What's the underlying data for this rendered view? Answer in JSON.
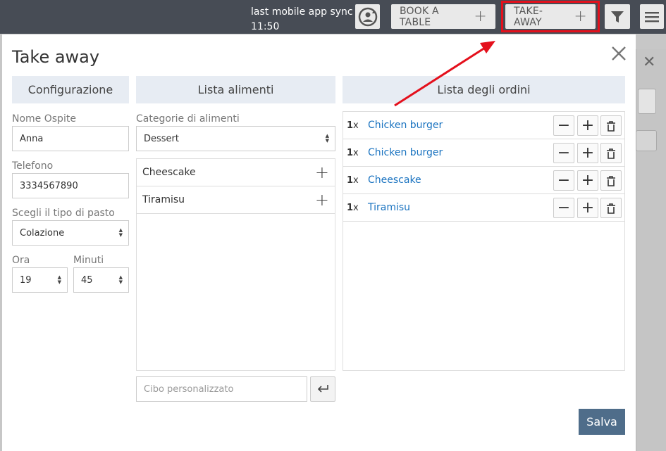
{
  "topbar": {
    "sync_label": "last mobile app sync",
    "sync_time": "11:50",
    "book_label": "BOOK A TABLE",
    "takeaway_label": "TAKE-AWAY"
  },
  "modal": {
    "title": "Take away",
    "columns": {
      "config": "Configurazione",
      "foods": "Lista alimenti",
      "orders": "Lista degli ordini"
    }
  },
  "config": {
    "guest_label": "Nome Ospite",
    "guest_value": "Anna",
    "phone_label": "Telefono",
    "phone_value": "3334567890",
    "meal_label": "Scegli il tipo di pasto",
    "meal_value": "Colazione",
    "hour_label": "Ora",
    "hour_value": "19",
    "minute_label": "Minuti",
    "minute_value": "45"
  },
  "foods": {
    "category_label": "Categorie di alimenti",
    "category_value": "Dessert",
    "items": [
      {
        "name": "Cheescake"
      },
      {
        "name": "Tiramisu"
      }
    ],
    "custom_placeholder": "Cibo personalizzato"
  },
  "orders": [
    {
      "qty": "1",
      "x": "x",
      "name": "Chicken burger"
    },
    {
      "qty": "1",
      "x": "x",
      "name": "Chicken burger"
    },
    {
      "qty": "1",
      "x": "x",
      "name": "Cheescake"
    },
    {
      "qty": "1",
      "x": "x",
      "name": "Tiramisu"
    }
  ],
  "save_label": "Salva",
  "colors": {
    "topbar": "#474c55",
    "column_header": "#e7ecf3",
    "link": "#1a73c0",
    "save_button": "#4f6d8a",
    "highlight": "#e4101c"
  },
  "icons": {
    "sync": "sync-icon",
    "filter": "filter-icon",
    "menu": "hamburger-icon",
    "close": "close-icon",
    "enter": "enter-icon",
    "trash": "trash-icon"
  }
}
